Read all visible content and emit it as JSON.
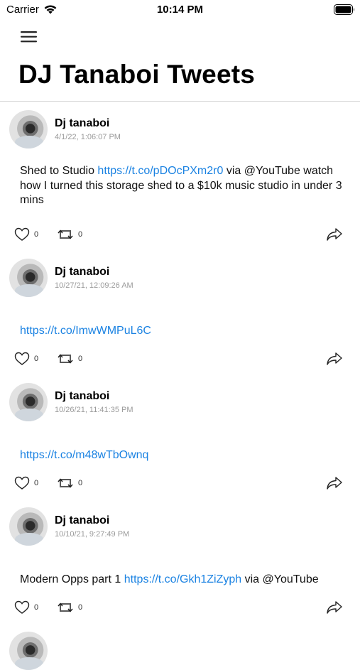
{
  "status_bar": {
    "carrier": "Carrier",
    "time": "10:14 PM"
  },
  "header": {
    "title": "DJ Tanaboi Tweets",
    "menu_icon": "hamburger-menu-icon"
  },
  "colors": {
    "link": "#1a82e2",
    "timestamp": "#9a9a9a",
    "divider": "#d6d6d6"
  },
  "tweets": [
    {
      "user": "Dj tanaboi",
      "timestamp": "4/1/22, 1:06:07 PM",
      "text_before": "Shed to Studio ",
      "link": "https://t.co/pDOcPXm2r0",
      "text_after": " via @YouTube watch how I turned this storage shed to a $10k music studio in under 3 mins",
      "likes": "0",
      "retweets": "0"
    },
    {
      "user": "Dj tanaboi",
      "timestamp": "10/27/21, 12:09:26 AM",
      "text_before": "",
      "link": "https://t.co/ImwWMPuL6C",
      "text_after": "",
      "likes": "0",
      "retweets": "0"
    },
    {
      "user": "Dj tanaboi",
      "timestamp": "10/26/21, 11:41:35 PM",
      "text_before": "",
      "link": "https://t.co/m48wTbOwnq",
      "text_after": "",
      "likes": "0",
      "retweets": "0"
    },
    {
      "user": "Dj tanaboi",
      "timestamp": "10/10/21, 9:27:49 PM",
      "text_before": "Modern Opps part 1 ",
      "link": "https://t.co/Gkh1ZiZyph",
      "text_after": " via @YouTube",
      "likes": "0",
      "retweets": "0"
    }
  ]
}
